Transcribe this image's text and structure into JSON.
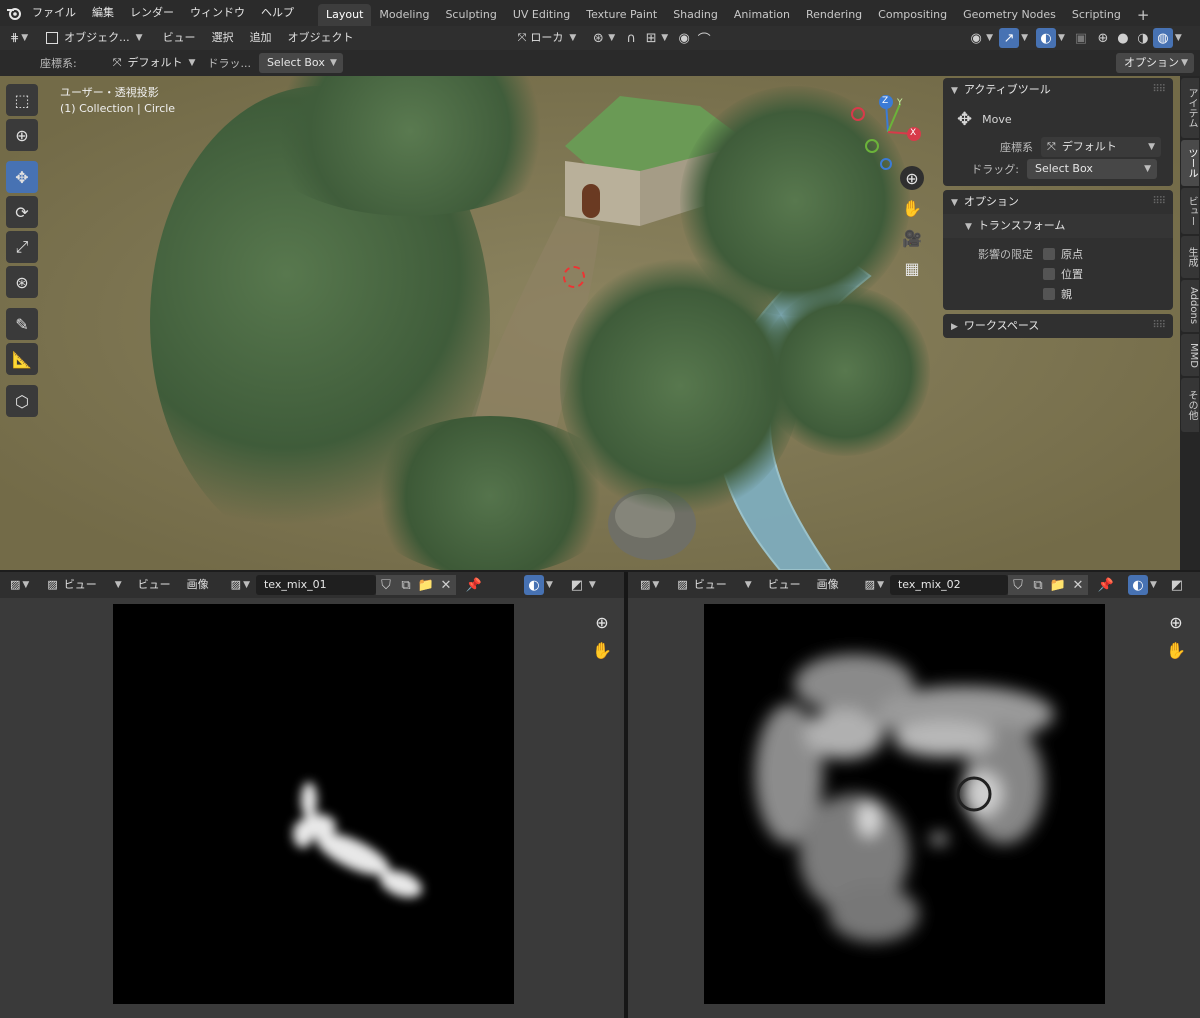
{
  "menu": {
    "items": [
      "ファイル",
      "編集",
      "レンダー",
      "ウィンドウ",
      "ヘルプ"
    ]
  },
  "workspaces": {
    "tabs": [
      "Layout",
      "Modeling",
      "Sculpting",
      "UV Editing",
      "Texture Paint",
      "Shading",
      "Animation",
      "Rendering",
      "Compositing",
      "Geometry Nodes",
      "Scripting"
    ],
    "active": "Layout",
    "add_label": "+"
  },
  "header": {
    "mode": "オブジェク...",
    "view": "ビュー",
    "select": "選択",
    "add": "追加",
    "object": "オブジェクト",
    "orientation": "ローカ"
  },
  "toolsettings": {
    "coord_label": "座標系:",
    "coord_value": "デフォルト",
    "drag_label": "ドラッ...",
    "drag_value": "Select Box",
    "options": "オプション"
  },
  "viewport": {
    "view_name": "ユーザー・透視投影",
    "collection": "(1) Collection | Circle",
    "gizmo": {
      "z": "Z",
      "y": "Y",
      "x": "X"
    }
  },
  "npanel": {
    "active_tool_title": "アクティブツール",
    "tool_name": "Move",
    "coord_label": "座標系",
    "coord_value": "デフォルト",
    "drag_label": "ドラッグ:",
    "drag_value": "Select Box",
    "options_title": "オプション",
    "transform_title": "トランスフォーム",
    "affect_label": "影響の限定",
    "affect": [
      "原点",
      "位置",
      "親"
    ],
    "workspace_title": "ワークスペース"
  },
  "sidetabs": [
    "アイテム",
    "ツール",
    "ビュー",
    "生成",
    "Addons",
    "MMD",
    "その他"
  ],
  "sidetab_active": "ツール",
  "image_editors": [
    {
      "view_menu": "ビュー",
      "view": "ビュー",
      "image": "画像",
      "name": "tex_mix_01"
    },
    {
      "view_menu": "ビュー",
      "view": "ビュー",
      "image": "画像",
      "name": "tex_mix_02"
    }
  ],
  "colors": {
    "accent": "#4772b3",
    "background": "#1d1d1d",
    "header": "#2f2f2f"
  }
}
